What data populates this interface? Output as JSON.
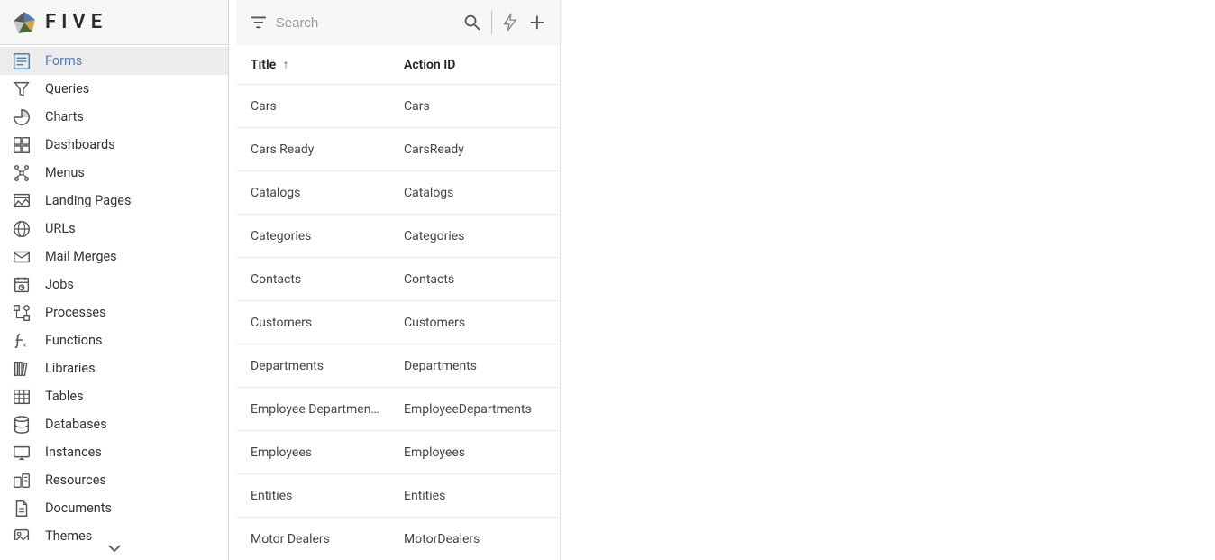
{
  "app": {
    "logo_text": "FIVE"
  },
  "sidebar": {
    "items": [
      {
        "icon": "form-icon",
        "label": "Forms",
        "active": true
      },
      {
        "icon": "query-icon",
        "label": "Queries",
        "active": false
      },
      {
        "icon": "chart-icon",
        "label": "Charts",
        "active": false
      },
      {
        "icon": "dashboard-icon",
        "label": "Dashboards",
        "active": false
      },
      {
        "icon": "menu-icon",
        "label": "Menus",
        "active": false
      },
      {
        "icon": "landing-icon",
        "label": "Landing Pages",
        "active": false
      },
      {
        "icon": "url-icon",
        "label": "URLs",
        "active": false
      },
      {
        "icon": "mail-icon",
        "label": "Mail Merges",
        "active": false
      },
      {
        "icon": "job-icon",
        "label": "Jobs",
        "active": false
      },
      {
        "icon": "process-icon",
        "label": "Processes",
        "active": false
      },
      {
        "icon": "function-icon",
        "label": "Functions",
        "active": false
      },
      {
        "icon": "library-icon",
        "label": "Libraries",
        "active": false
      },
      {
        "icon": "table-icon",
        "label": "Tables",
        "active": false
      },
      {
        "icon": "database-icon",
        "label": "Databases",
        "active": false
      },
      {
        "icon": "instance-icon",
        "label": "Instances",
        "active": false
      },
      {
        "icon": "resource-icon",
        "label": "Resources",
        "active": false
      },
      {
        "icon": "document-icon",
        "label": "Documents",
        "active": false
      },
      {
        "icon": "theme-icon",
        "label": "Themes",
        "active": false
      }
    ]
  },
  "toolbar": {
    "search_placeholder": "Search"
  },
  "table": {
    "columns": {
      "title": "Title",
      "action_id": "Action ID"
    },
    "sort": {
      "column": "title",
      "dir": "asc"
    },
    "rows": [
      {
        "title": "Cars",
        "action_id": "Cars"
      },
      {
        "title": "Cars Ready",
        "action_id": "CarsReady"
      },
      {
        "title": "Catalogs",
        "action_id": "Catalogs"
      },
      {
        "title": "Categories",
        "action_id": "Categories"
      },
      {
        "title": "Contacts",
        "action_id": "Contacts"
      },
      {
        "title": "Customers",
        "action_id": "Customers"
      },
      {
        "title": "Departments",
        "action_id": "Departments"
      },
      {
        "title": "Employee Departmen…",
        "action_id": "EmployeeDepartments"
      },
      {
        "title": "Employees",
        "action_id": "Employees"
      },
      {
        "title": "Entities",
        "action_id": "Entities"
      },
      {
        "title": "Motor Dealers",
        "action_id": "MotorDealers"
      }
    ]
  }
}
